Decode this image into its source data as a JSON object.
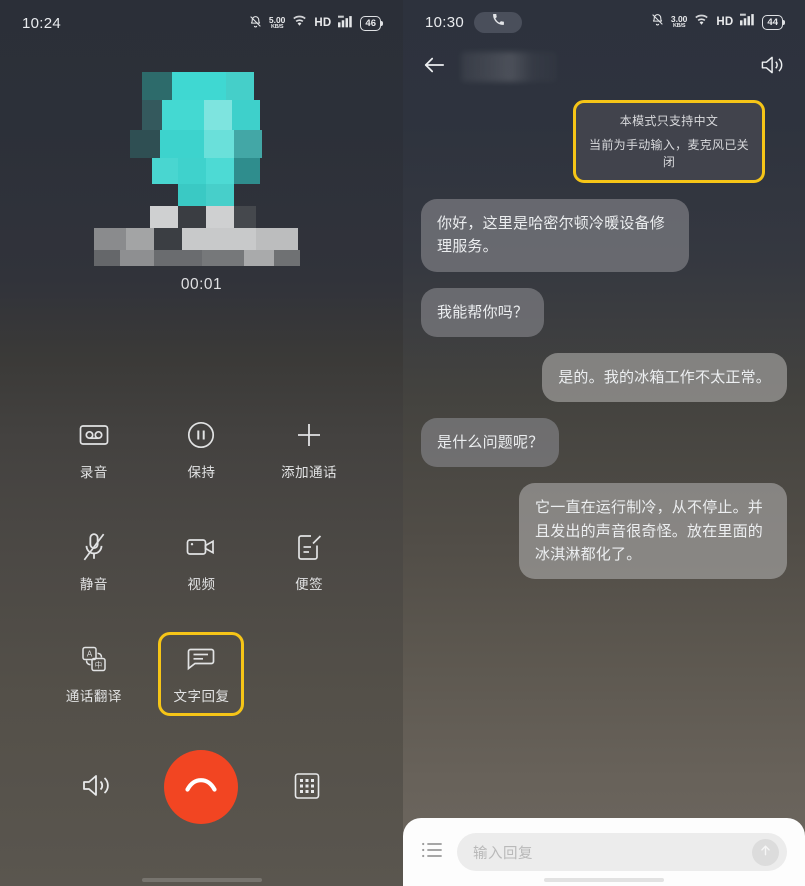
{
  "call_screen": {
    "status_bar": {
      "time": "10:24",
      "net_speed_value": "5.00",
      "net_speed_unit": "KB/S",
      "hd_label": "HD",
      "battery": "46",
      "icons": [
        "mute-bell-icon",
        "wifi-icon",
        "hd-icon",
        "signal-icon",
        "battery-icon"
      ]
    },
    "avatar_name": "",
    "timer": "00:01",
    "options": [
      {
        "label": "录音",
        "icon": "cassette-record-icon",
        "selected": false
      },
      {
        "label": "保持",
        "icon": "pause-circle-icon",
        "selected": false
      },
      {
        "label": "添加通话",
        "icon": "plus-icon",
        "selected": false
      },
      {
        "label": "静音",
        "icon": "mic-off-icon",
        "selected": false
      },
      {
        "label": "视频",
        "icon": "video-camera-icon",
        "selected": false
      },
      {
        "label": "便签",
        "icon": "note-edit-icon",
        "selected": false
      },
      {
        "label": "通话翻译",
        "icon": "translate-icon",
        "selected": false
      },
      {
        "label": "文字回复",
        "icon": "text-reply-icon",
        "selected": true
      }
    ],
    "bottom_controls": [
      {
        "name": "speaker-button",
        "icon": "speaker-icon"
      },
      {
        "name": "end-call-button",
        "icon": "phone-hangup-icon"
      },
      {
        "name": "keypad-button",
        "icon": "dialpad-icon"
      }
    ]
  },
  "chat_screen": {
    "status_bar": {
      "time": "10:30",
      "call_pill_icon": "phone-icon",
      "net_speed_value": "3.00",
      "net_speed_unit": "KB/S",
      "hd_label": "HD",
      "battery": "44"
    },
    "nav": {
      "back_icon": "back-arrow-icon",
      "title": "",
      "speaker_icon": "speaker-icon"
    },
    "notice": {
      "line1": "本模式只支持中文",
      "line2": "当前为手动输入，麦克风已关闭"
    },
    "messages": [
      {
        "side": "in",
        "text": "你好，这里是哈密尔顿冷暖设备修理服务。"
      },
      {
        "side": "in",
        "text": "我能帮你吗？"
      },
      {
        "side": "out",
        "text": "是的。我的冰箱工作不太正常。"
      },
      {
        "side": "in",
        "text": "是什么问题呢？"
      },
      {
        "side": "out",
        "text": "它一直在运行制冷，从不停止。并且发出的声音很奇怪。放在里面的冰淇淋都化了。"
      }
    ],
    "input": {
      "list_icon": "quick-reply-list-icon",
      "placeholder": "输入回复",
      "value": "",
      "send_icon": "send-arrow-up-icon"
    }
  },
  "colors": {
    "accent_yellow": "#f6c517",
    "end_call_red": "#f24522",
    "avatar_teal": "#3fd8d2",
    "text_light": "#e9eaec"
  }
}
